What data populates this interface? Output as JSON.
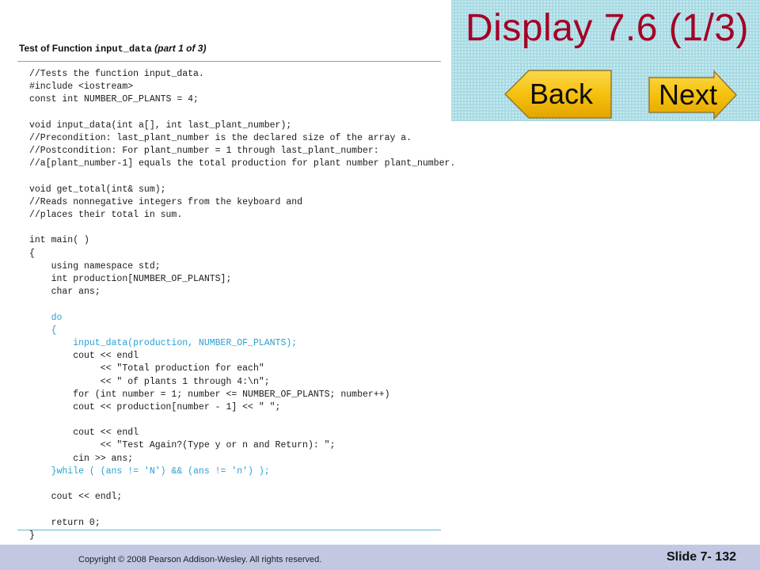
{
  "slide": {
    "title": "Display 7.6 (1/3)",
    "back_label": "Back",
    "next_label": "Next"
  },
  "document": {
    "title_prefix": "Test of Function ",
    "title_function": "input_data",
    "title_suffix": " (part 1 of 3)",
    "code_lines": [
      {
        "text": "//Tests the function input_data.",
        "highlight": false
      },
      {
        "text": "#include <iostream>",
        "highlight": false
      },
      {
        "text": "const int NUMBER_OF_PLANTS = 4;",
        "highlight": false
      },
      {
        "text": "",
        "highlight": false
      },
      {
        "text": "void input_data(int a[], int last_plant_number);",
        "highlight": false
      },
      {
        "text": "//Precondition: last_plant_number is the declared size of the array a.",
        "highlight": false
      },
      {
        "text": "//Postcondition: For plant_number = 1 through last_plant_number:",
        "highlight": false
      },
      {
        "text": "//a[plant_number-1] equals the total production for plant number plant_number.",
        "highlight": false
      },
      {
        "text": "",
        "highlight": false
      },
      {
        "text": "void get_total(int& sum);",
        "highlight": false
      },
      {
        "text": "//Reads nonnegative integers from the keyboard and",
        "highlight": false
      },
      {
        "text": "//places their total in sum.",
        "highlight": false
      },
      {
        "text": "",
        "highlight": false
      },
      {
        "text": "int main( )",
        "highlight": false
      },
      {
        "text": "{",
        "highlight": false
      },
      {
        "text": "    using namespace std;",
        "highlight": false
      },
      {
        "text": "    int production[NUMBER_OF_PLANTS];",
        "highlight": false
      },
      {
        "text": "    char ans;",
        "highlight": false
      },
      {
        "text": "",
        "highlight": false
      },
      {
        "text": "    do",
        "highlight": true
      },
      {
        "text": "    {",
        "highlight": true
      },
      {
        "text": "        input_data(production, NUMBER_OF_PLANTS);",
        "highlight": true
      },
      {
        "text": "        cout << endl",
        "highlight": false
      },
      {
        "text": "             << \"Total production for each\"",
        "highlight": false
      },
      {
        "text": "             << \" of plants 1 through 4:\\n\";",
        "highlight": false
      },
      {
        "text": "        for (int number = 1; number <= NUMBER_OF_PLANTS; number++)",
        "highlight": false
      },
      {
        "text": "        cout << production[number - 1] << \" \";",
        "highlight": false
      },
      {
        "text": "",
        "highlight": false
      },
      {
        "text": "        cout << endl",
        "highlight": false
      },
      {
        "text": "             << \"Test Again?(Type y or n and Return): \";",
        "highlight": false
      },
      {
        "text": "        cin >> ans;",
        "highlight": false
      },
      {
        "text": "    }while ( (ans != 'N') && (ans != 'n') );",
        "highlight": true
      },
      {
        "text": "",
        "highlight": false
      },
      {
        "text": "    cout << endl;",
        "highlight": false
      },
      {
        "text": "",
        "highlight": false
      },
      {
        "text": "    return 0;",
        "highlight": false
      },
      {
        "text": "}",
        "highlight": false
      }
    ]
  },
  "footer": {
    "copyright": "Copyright © 2008 Pearson Addison-Wesley.  All rights reserved.",
    "slide_number": "Slide 7- 132"
  },
  "colors": {
    "title": "#a40025",
    "header_panel": "#a9dbe4",
    "nav_button": "#f9c50f",
    "code_highlight": "#2a9fd0",
    "rule": "#59b6d3",
    "footer_bar": "#c2c8e2"
  }
}
